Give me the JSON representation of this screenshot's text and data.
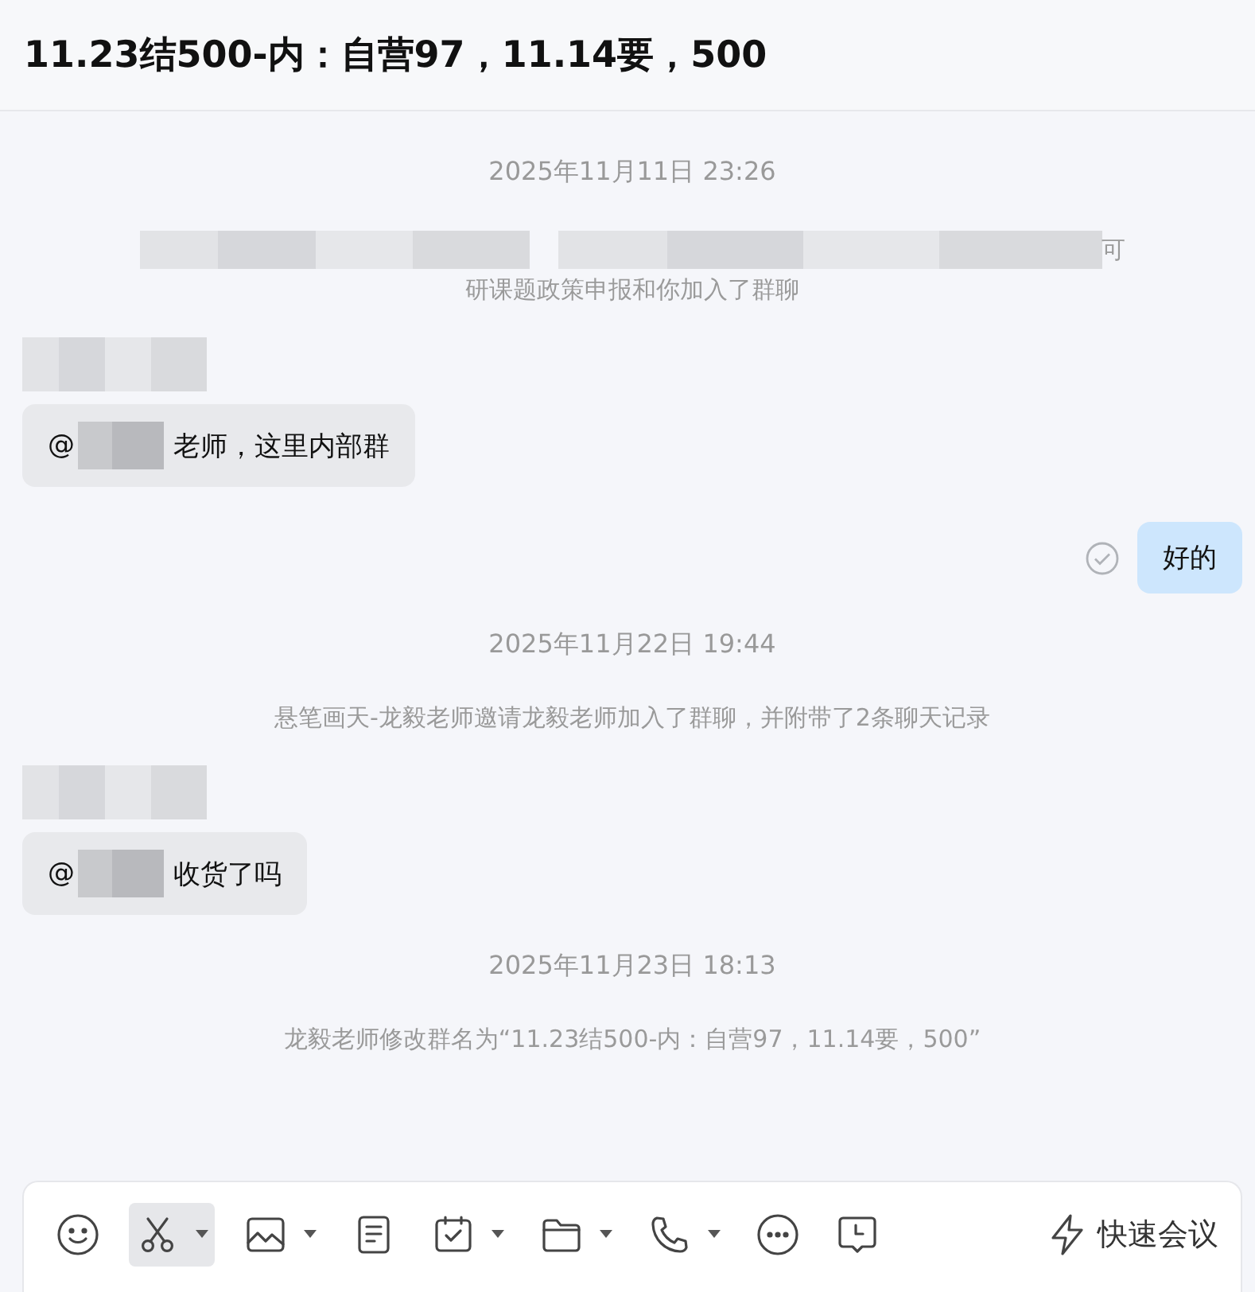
{
  "title": "11.23结500-内：自营97，11.14要，500",
  "messages": [
    {
      "kind": "time",
      "text": "2025年11月11日 23:26"
    },
    {
      "kind": "system",
      "redacted": true,
      "lines": [
        "可",
        "研课题政策申报和你加入了群聊"
      ]
    },
    {
      "kind": "incoming",
      "sender_redacted": true,
      "mention": "@",
      "text": "老师，这里内部群"
    },
    {
      "kind": "outgoing",
      "read": true,
      "text": "好的"
    },
    {
      "kind": "time",
      "text": "2025年11月22日 19:44"
    },
    {
      "kind": "system",
      "redacted": false,
      "lines": [
        "悬笔画天-龙毅老师邀请龙毅老师加入了群聊，并附带了2条聊天记录"
      ]
    },
    {
      "kind": "incoming",
      "sender_redacted": true,
      "mention": "@",
      "text": "收货了吗"
    },
    {
      "kind": "time",
      "text": "2025年11月23日 18:13"
    },
    {
      "kind": "system",
      "redacted": false,
      "lines": [
        "龙毅老师修改群名为“11.23结500-内：自营97，11.14要，500”"
      ]
    }
  ],
  "toolbar": [
    {
      "kind": "emoji",
      "dropdown": false,
      "selected": false
    },
    {
      "kind": "scissors",
      "dropdown": true,
      "selected": true
    },
    {
      "kind": "image",
      "dropdown": true,
      "selected": false
    },
    {
      "kind": "document",
      "dropdown": false,
      "selected": false
    },
    {
      "kind": "calendar",
      "dropdown": true,
      "selected": false
    },
    {
      "kind": "folder",
      "dropdown": true,
      "selected": false
    },
    {
      "kind": "phone",
      "dropdown": true,
      "selected": false
    },
    {
      "kind": "more",
      "dropdown": false,
      "selected": false
    },
    {
      "kind": "clock",
      "dropdown": false,
      "selected": false
    }
  ],
  "meeting_button": "快速会议"
}
